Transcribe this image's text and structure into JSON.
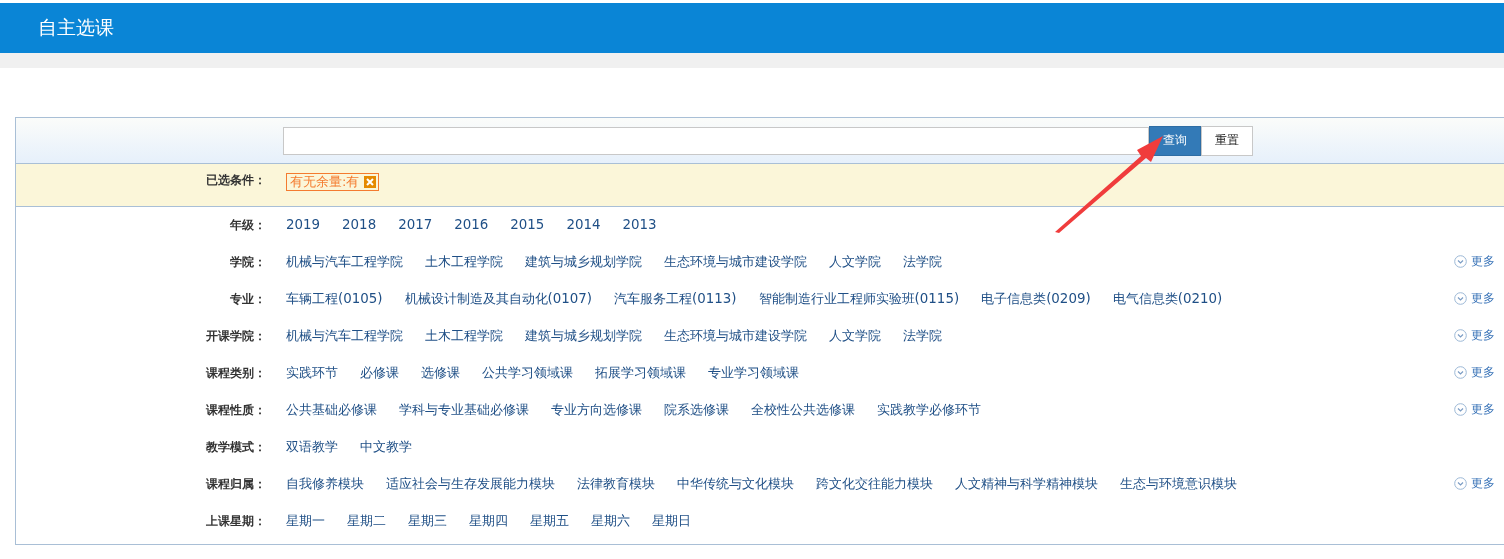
{
  "header": {
    "title": "自主选课"
  },
  "search": {
    "buttons": [
      {
        "label": "查询",
        "kind": "primary"
      },
      {
        "label": "重置",
        "kind": "default"
      }
    ]
  },
  "selected_conditions": {
    "label": "已选条件：",
    "tags": [
      {
        "text": "有无余量:有"
      }
    ]
  },
  "filters": [
    {
      "label": "年级：",
      "options": [
        "2019",
        "2018",
        "2017",
        "2016",
        "2015",
        "2014",
        "2013"
      ]
    },
    {
      "label": "学院：",
      "options": [
        "机械与汽车工程学院",
        "土木工程学院",
        "建筑与城乡规划学院",
        "生态环境与城市建设学院",
        "人文学院",
        "法学院"
      ],
      "more": "更多"
    },
    {
      "label": "专业：",
      "options": [
        "车辆工程(0105)",
        "机械设计制造及其自动化(0107)",
        "汽车服务工程(0113)",
        "智能制造行业工程师实验班(0115)",
        "电子信息类(0209)",
        "电气信息类(0210)"
      ],
      "more": "更多"
    },
    {
      "label": "开课学院：",
      "options": [
        "机械与汽车工程学院",
        "土木工程学院",
        "建筑与城乡规划学院",
        "生态环境与城市建设学院",
        "人文学院",
        "法学院"
      ],
      "more": "更多"
    },
    {
      "label": "课程类别：",
      "options": [
        "实践环节",
        "必修课",
        "选修课",
        "公共学习领域课",
        "拓展学习领域课",
        "专业学习领域课"
      ],
      "more": "更多"
    },
    {
      "label": "课程性质：",
      "options": [
        "公共基础必修课",
        "学科与专业基础必修课",
        "专业方向选修课",
        "院系选修课",
        "全校性公共选修课",
        "实践教学必修环节"
      ],
      "more": "更多"
    },
    {
      "label": "教学模式：",
      "options": [
        "双语教学",
        "中文教学"
      ]
    },
    {
      "label": "课程归属：",
      "options": [
        "自我修养模块",
        "适应社会与生存发展能力模块",
        "法律教育模块",
        "中华传统与文化模块",
        "跨文化交往能力模块",
        "人文精神与科学精神模块",
        "生态与环境意识模块"
      ],
      "more": "更多"
    },
    {
      "label": "上课星期：",
      "options": [
        "星期一",
        "星期二",
        "星期三",
        "星期四",
        "星期五",
        "星期六",
        "星期日"
      ]
    }
  ]
}
